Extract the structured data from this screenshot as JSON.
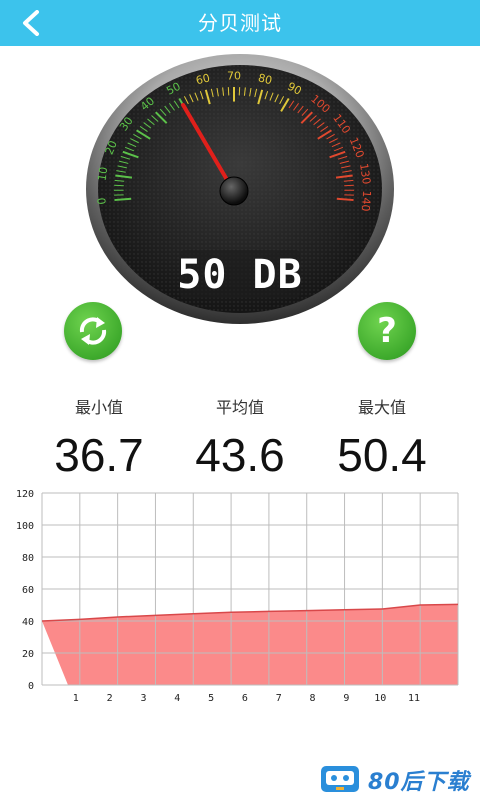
{
  "header": {
    "title": "分贝测试",
    "back_icon": "back-arrow-icon"
  },
  "meter": {
    "reading_text": "50 DB",
    "value": 50,
    "min": 0,
    "max": 140,
    "ticks": [
      "0",
      "10",
      "20",
      "30",
      "40",
      "50",
      "60",
      "70",
      "80",
      "90",
      "100",
      "110",
      "120",
      "130",
      "140"
    ],
    "colors": {
      "face": "#2a2a2a",
      "low_tick": "#5cc24a",
      "mid_tick": "#e0c83a",
      "high_tick": "#e2492f",
      "needle": "#e0201b"
    }
  },
  "buttons": {
    "refresh_icon": "refresh-icon",
    "help_icon": "question-icon",
    "help_label": "?"
  },
  "stats": {
    "min": {
      "label": "最小值",
      "value": "36.7"
    },
    "avg": {
      "label": "平均值",
      "value": "43.6"
    },
    "max": {
      "label": "最大值",
      "value": "50.4"
    }
  },
  "chart_data": {
    "type": "area",
    "y_ticks": [
      "0",
      "20",
      "40",
      "60",
      "80",
      "100",
      "120"
    ],
    "x_ticks": [
      "1",
      "2",
      "3",
      "4",
      "5",
      "6",
      "7",
      "8",
      "9",
      "10",
      "11"
    ],
    "ylim": [
      0,
      120
    ],
    "x": [
      0,
      1,
      2,
      3,
      4,
      5,
      6,
      7,
      8,
      9,
      10,
      11
    ],
    "values": [
      40,
      41,
      42.5,
      43.5,
      44.5,
      45.5,
      46,
      46.5,
      47,
      47.5,
      50,
      50.4
    ],
    "grid": true,
    "fill_color": "#fb8a8a",
    "line_color": "#d8484a"
  },
  "watermark": {
    "text": "80后下载"
  }
}
